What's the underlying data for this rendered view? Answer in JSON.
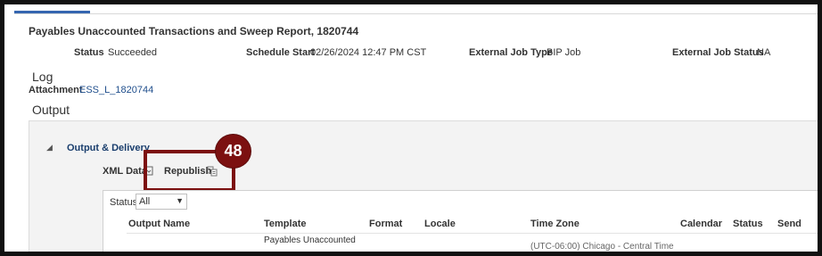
{
  "report": {
    "title": "Payables Unaccounted Transactions and Sweep Report, 1820744"
  },
  "meta": {
    "status_label": "Status",
    "status_value": "Succeeded",
    "schedule_start_label": "Schedule Start",
    "schedule_start_value": "02/26/2024 12:47 PM CST",
    "external_job_type_label": "External Job Type",
    "external_job_type_value": "BIP Job",
    "external_job_status_label": "External Job Status",
    "external_job_status_value": "NA"
  },
  "sections": {
    "log": "Log",
    "attachment_label": "Attachment",
    "attachment_link": "ESS_L_1820744",
    "output": "Output"
  },
  "output_delivery": {
    "header": "Output & Delivery",
    "disclosure_icon": "triangle-down-icon",
    "xml_data_label": "XML Data",
    "republish_label": "Republish",
    "step_badge": "48",
    "highlight_color": "#7c1010"
  },
  "filter": {
    "status_label": "Status",
    "status_selected": "All"
  },
  "table": {
    "columns": [
      "Output Name",
      "Template",
      "Format",
      "Locale",
      "Time Zone",
      "Calendar",
      "Status",
      "Send"
    ],
    "rows": [
      {
        "template": "Payables Unaccounted",
        "time_zone": "(UTC-06:00) Chicago - Central Time"
      }
    ]
  },
  "colors": {
    "accent_tab": "#3566b0",
    "link": "#1f4e8c",
    "badge": "#7c1010"
  }
}
